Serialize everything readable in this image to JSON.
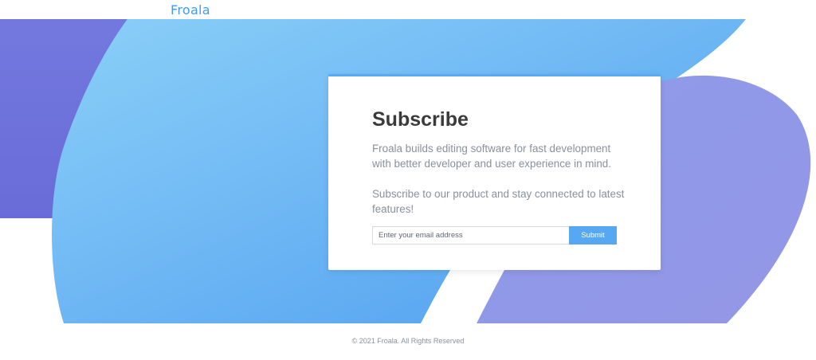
{
  "header": {
    "logo_text": "Froala"
  },
  "hero": {
    "colors": {
      "left_blob": "#6f72dd",
      "main_gradient_start": "#8bd0f8",
      "main_gradient_end": "#4e9cf0",
      "right_blob": "#8e98e8",
      "card_accent": "#5aa9f2"
    }
  },
  "card": {
    "title": "Subscribe",
    "paragraph_1": "Froala builds editing software for fast development with better developer and user experience in mind.",
    "paragraph_2": "Subscribe to our product and stay connected to latest features!",
    "email_placeholder": "Enter your email address",
    "email_value": "",
    "submit_label": "Submit"
  },
  "footer": {
    "copyright": "© 2021 Froala. All Rights Reserved"
  }
}
